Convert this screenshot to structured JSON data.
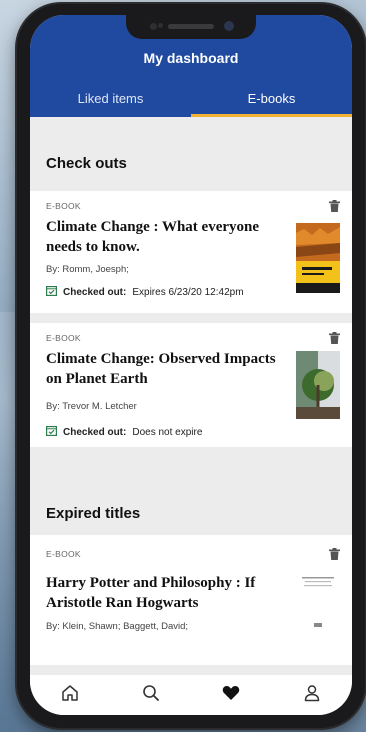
{
  "header": {
    "title": "My dashboard"
  },
  "tabs": [
    {
      "label": "Liked items",
      "active": false
    },
    {
      "label": "E-books",
      "active": true
    }
  ],
  "sections": {
    "checkouts_title": "Check outs",
    "expired_title": "Expired titles"
  },
  "checkouts": [
    {
      "format": "E-BOOK",
      "title": "Climate Change : What everyone needs to know.",
      "author": "By: Romm, Joesph;",
      "status_label": "Checked out:",
      "status_value": "Expires 6/23/20 12:42pm"
    },
    {
      "format": "E-BOOK",
      "title": "Climate Change: Observed Impacts on Planet Earth",
      "author": "By: Trevor M. Letcher",
      "status_label": "Checked out:",
      "status_value": "Does not expire"
    }
  ],
  "expired": [
    {
      "format": "E-BOOK",
      "title": "Harry Potter and Philosophy : If Aristotle Ran Hogwarts",
      "author": "By: Klein, Shawn; Baggett, David;"
    }
  ],
  "bottom_nav": [
    "home-icon",
    "search-icon",
    "heart-icon",
    "user-icon"
  ],
  "colors": {
    "header": "#1f4aa0",
    "tab_indicator": "#f2b233",
    "status_icon": "#2e7d4f"
  }
}
